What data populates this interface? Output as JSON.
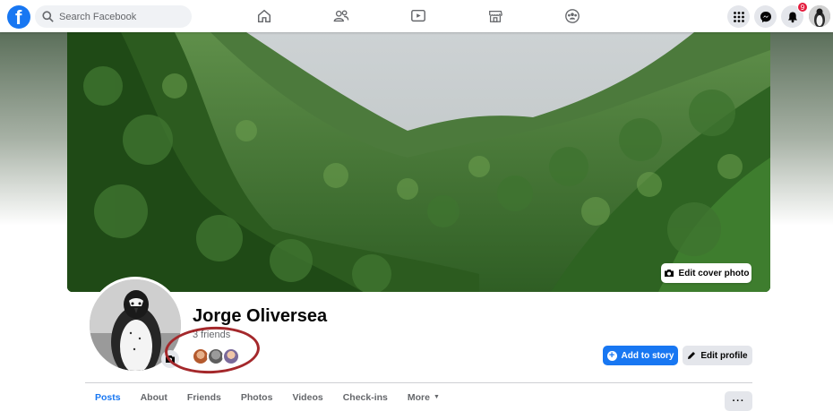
{
  "nav": {
    "search_placeholder": "Search Facebook",
    "logo_letter": "f",
    "notification_count": "9",
    "icons": [
      "home-icon",
      "friends-icon",
      "watch-icon",
      "marketplace-icon",
      "groups-icon"
    ],
    "right_icons": [
      "menu-grid-icon",
      "messenger-icon",
      "notifications-icon"
    ]
  },
  "cover": {
    "edit_label": "Edit cover photo"
  },
  "profile": {
    "name": "Jorge Oliversea",
    "friend_count": "3 friends",
    "add_story_label": "Add to story",
    "edit_profile_label": "Edit profile"
  },
  "tabs": [
    {
      "label": "Posts",
      "active": true
    },
    {
      "label": "About"
    },
    {
      "label": "Friends"
    },
    {
      "label": "Photos"
    },
    {
      "label": "Videos"
    },
    {
      "label": "Check-ins"
    },
    {
      "label": "More"
    }
  ],
  "more_button": "···",
  "colors": {
    "brand": "#1877f2",
    "highlight_ring": "#a4282b",
    "badge": "#e41e3f"
  }
}
